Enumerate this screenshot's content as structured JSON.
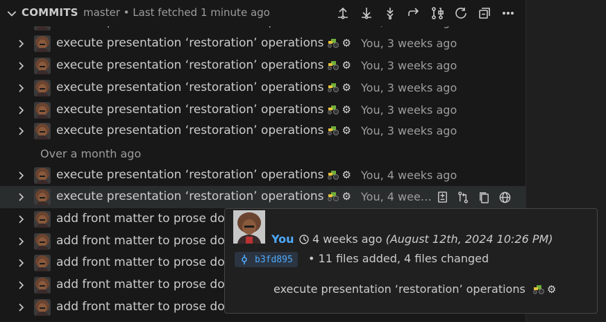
{
  "header": {
    "title": "COMMITS",
    "description": "master • Last fetched 1 minute ago",
    "actions": [
      "push-icon",
      "pull-icon",
      "fetch-icon",
      "switch-branch-icon",
      "compare-icon",
      "refresh-icon",
      "collapse-all-icon",
      "more-icon"
    ]
  },
  "commits_top": [
    {
      "message": "execute presentation ‘restoration’ operations",
      "meta": "You, 3 weeks ago"
    },
    {
      "message": "execute presentation ‘restoration’ operations",
      "meta": "You, 3 weeks ago"
    },
    {
      "message": "execute presentation ‘restoration’ operations",
      "meta": "You, 3 weeks ago"
    },
    {
      "message": "execute presentation ‘restoration’ operations",
      "meta": "You, 3 weeks ago"
    },
    {
      "message": "execute presentation ‘restoration’ operations",
      "meta": "You, 3 weeks ago"
    },
    {
      "message": "execute presentation ‘restoration’ operations",
      "meta": "You, 3 weeks ago"
    }
  ],
  "group_label": "Over a month ago",
  "commits_bottom": [
    {
      "message": "execute presentation ‘restoration’ operations",
      "meta": "You, 4 weeks ago"
    },
    {
      "message": "execute presentation ‘restoration’ operations",
      "meta": "You, 4 wee…"
    },
    {
      "message": "add front matter to prose do"
    },
    {
      "message": "add front matter to prose do"
    },
    {
      "message": "add front matter to prose do"
    },
    {
      "message": "add front matter to prose do"
    },
    {
      "message": "add front matter to prose do"
    }
  ],
  "gear_glyph": "⚙",
  "row_actions": [
    "open-changes-icon",
    "compare-icon",
    "copy-icon",
    "globe-icon"
  ],
  "tooltip": {
    "author": "You",
    "relative_date": "4 weeks ago",
    "absolute_date": "(August 12th, 2024 10:26 PM)",
    "sha": "b3fd895",
    "files_summary": "• 11 files added, 4 files changed",
    "message": "execute presentation ‘restoration’ operations"
  },
  "colors": {
    "background": "#181818",
    "hover_row": "#2a2d2e",
    "link_blue": "#4daafc",
    "muted_text": "#9d9d9d"
  }
}
